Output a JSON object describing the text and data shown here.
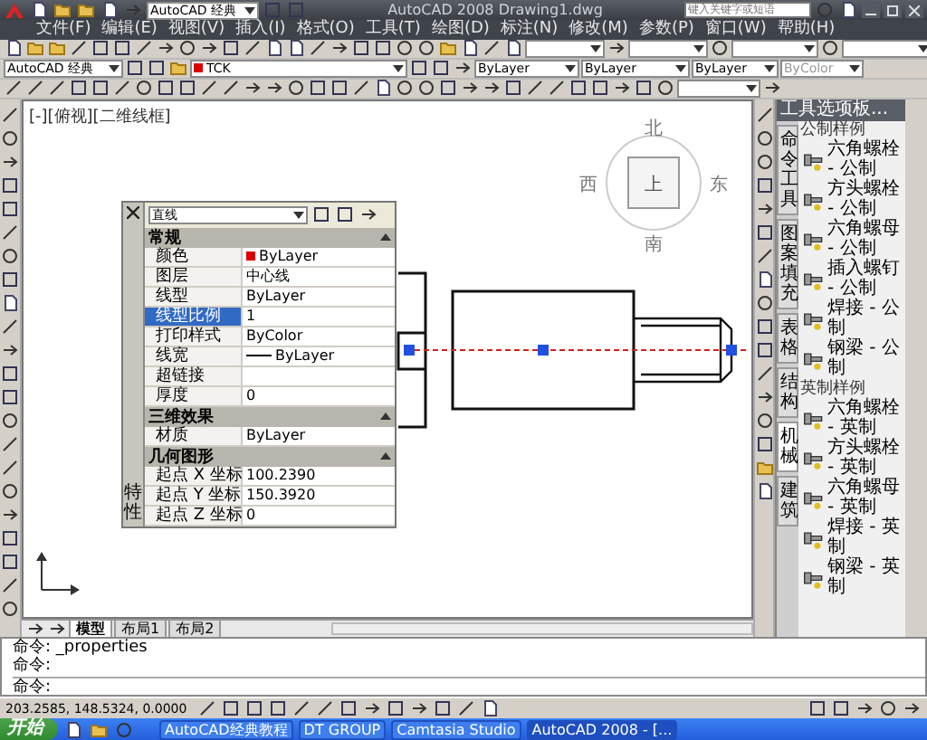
{
  "window": {
    "title": "AutoCAD 2008  Drawing1.dwg",
    "workspace": "AutoCAD 经典",
    "search_placeholder": "键入关键字或短语"
  },
  "menu": [
    "文件(F)",
    "编辑(E)",
    "视图(V)",
    "插入(I)",
    "格式(O)",
    "工具(T)",
    "绘图(D)",
    "标注(N)",
    "修改(M)",
    "参数(P)",
    "窗口(W)",
    "帮助(H)"
  ],
  "toolbar": {
    "workspace": "AutoCAD 经典",
    "layer": "TCK",
    "color_control": "ByLayer",
    "linetype": "ByLayer",
    "lineweight": "ByLayer",
    "plot_style": "ByColor"
  },
  "viewport": {
    "label": "[-][俯视][二维线框]",
    "viewcube": {
      "top": "上",
      "north": "北",
      "south": "南",
      "west": "西",
      "east": "东"
    }
  },
  "properties": {
    "title": "特性",
    "object": "直线",
    "sections": [
      {
        "title": "常规",
        "expanded": true,
        "rows": [
          {
            "name": "颜色",
            "value": "ByLayer",
            "kind": "color",
            "selected": false
          },
          {
            "name": "图层",
            "value": "中心线",
            "kind": "text",
            "selected": false
          },
          {
            "name": "线型",
            "value": "ByLayer",
            "kind": "text",
            "selected": false
          },
          {
            "name": "线型比例",
            "value": "1",
            "kind": "text",
            "selected": true
          },
          {
            "name": "打印样式",
            "value": "ByColor",
            "kind": "text",
            "selected": false
          },
          {
            "name": "线宽",
            "value": "ByLayer",
            "kind": "line",
            "selected": false
          },
          {
            "name": "超链接",
            "kind": "text",
            "selected": false
          },
          {
            "name": "厚度",
            "value": "0",
            "kind": "text",
            "selected": false
          }
        ]
      },
      {
        "title": "三维效果",
        "expanded": true,
        "rows": [
          {
            "name": "材质",
            "value": "ByLayer",
            "kind": "text",
            "selected": false
          }
        ]
      },
      {
        "title": "几何图形",
        "expanded": true,
        "rows": [
          {
            "name": "起点 X 坐标",
            "value": "100.2390",
            "kind": "text",
            "selected": false
          },
          {
            "name": "起点 Y 坐标",
            "value": "150.3920",
            "kind": "text",
            "selected": false
          },
          {
            "name": "起点 Z 坐标",
            "value": "0",
            "kind": "text",
            "selected": false
          }
        ]
      }
    ]
  },
  "model_tabs": [
    {
      "label": "模型",
      "selected": true
    },
    {
      "label": "布局1",
      "selected": false
    },
    {
      "label": "布局2",
      "selected": false
    }
  ],
  "palette": {
    "title": "工具选项板...",
    "tabs": [
      {
        "label": "命令工具",
        "selected": false
      },
      {
        "label": "图案填充",
        "selected": false
      },
      {
        "label": "表格",
        "selected": false
      },
      {
        "label": "结构",
        "selected": false
      },
      {
        "label": "机械",
        "selected": true
      },
      {
        "label": "建筑",
        "selected": false
      }
    ],
    "groups": [
      {
        "title": "公制样例",
        "items": [
          "六角螺栓 - 公制",
          "方头螺栓 - 公制",
          "六角螺母 - 公制",
          "插入螺钉 - 公制",
          "焊接 - 公制",
          "钢梁 - 公制"
        ]
      },
      {
        "title": "英制样例",
        "items": [
          "六角螺栓 - 英制",
          "方头螺栓 - 英制",
          "六角螺母 - 英制",
          "焊接 - 英制",
          "钢梁 - 英制"
        ]
      }
    ]
  },
  "command": {
    "history": [
      "命令: _properties",
      "命令:"
    ],
    "prompt": "命令:"
  },
  "status": {
    "coordinates": "203.2585, 148.5324, 0.0000"
  },
  "taskbar": {
    "start": "开始",
    "tasks": [
      {
        "label": "AutoCAD经典教程",
        "selected": false
      },
      {
        "label": "DT GROUP",
        "selected": false
      },
      {
        "label": "Camtasia Studio",
        "selected": false
      },
      {
        "label": "AutoCAD 2008 - [...",
        "selected": true
      }
    ]
  }
}
